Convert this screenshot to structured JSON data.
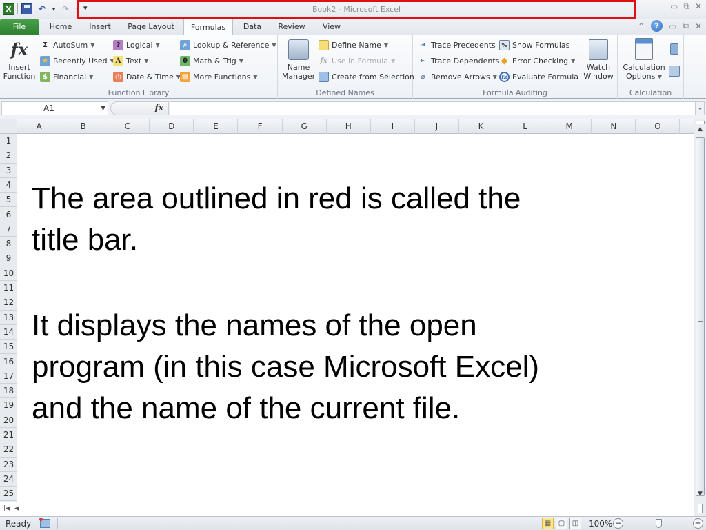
{
  "window": {
    "title": "Book2  -  Microsoft Excel",
    "outline_color": "#e01010",
    "app_icon": "excel-icon"
  },
  "quick_access": {
    "items": [
      {
        "name": "save",
        "icon": "save-icon"
      },
      {
        "name": "undo",
        "icon": "undo-icon"
      },
      {
        "name": "redo",
        "icon": "redo-icon"
      },
      {
        "name": "customize",
        "icon": "customize-qat-icon",
        "glyph": "▾"
      }
    ]
  },
  "window_controls": {
    "minimize": "▭",
    "restore": "⧉",
    "close": "✕"
  },
  "tabs": [
    {
      "label": "File",
      "active": false
    },
    {
      "label": "Home",
      "active": false
    },
    {
      "label": "Insert",
      "active": false
    },
    {
      "label": "Page Layout",
      "active": false
    },
    {
      "label": "Formulas",
      "active": true
    },
    {
      "label": "Data",
      "active": false
    },
    {
      "label": "Review",
      "active": false
    },
    {
      "label": "View",
      "active": false
    }
  ],
  "ribbon_right": {
    "collapse": "⌃",
    "help": "?",
    "minimize": "▭",
    "restore": "⧉",
    "close": "✕"
  },
  "ribbon": {
    "insert_function": {
      "line1": "Insert",
      "line2": "Function",
      "glyph": "fx"
    },
    "function_library": {
      "label": "Function Library",
      "buttons": [
        {
          "label": "AutoSum",
          "dropdown": true,
          "icon": "sigma-icon",
          "glyph": "Σ"
        },
        {
          "label": "Recently Used",
          "dropdown": true,
          "icon": "recently-used-icon",
          "glyph": "★"
        },
        {
          "label": "Financial",
          "dropdown": true,
          "icon": "financial-icon",
          "glyph": "$"
        },
        {
          "label": "Logical",
          "dropdown": true,
          "icon": "logical-icon",
          "glyph": "?"
        },
        {
          "label": "Text",
          "dropdown": true,
          "icon": "text-icon",
          "glyph": "A"
        },
        {
          "label": "Date & Time",
          "dropdown": true,
          "icon": "date-time-icon",
          "glyph": "◷"
        },
        {
          "label": "Lookup & Reference",
          "dropdown": true,
          "icon": "lookup-icon",
          "glyph": "⌕"
        },
        {
          "label": "Math & Trig",
          "dropdown": true,
          "icon": "math-trig-icon",
          "glyph": "θ"
        },
        {
          "label": "More Functions",
          "dropdown": true,
          "icon": "more-functions-icon",
          "glyph": "▤"
        }
      ]
    },
    "defined_names": {
      "label": "Defined Names",
      "name_manager": {
        "line1": "Name",
        "line2": "Manager"
      },
      "buttons": [
        {
          "label": "Define Name",
          "dropdown": true,
          "disabled": false
        },
        {
          "label": "Use in Formula",
          "dropdown": true,
          "disabled": true
        },
        {
          "label": "Create from Selection",
          "dropdown": false,
          "disabled": false
        }
      ]
    },
    "formula_auditing": {
      "label": "Formula Auditing",
      "buttons": [
        {
          "label": "Trace Precedents",
          "dropdown": false
        },
        {
          "label": "Trace Dependents",
          "dropdown": false
        },
        {
          "label": "Remove Arrows",
          "dropdown": true
        },
        {
          "label": "Show Formulas",
          "dropdown": false
        },
        {
          "label": "Error Checking",
          "dropdown": true
        },
        {
          "label": "Evaluate Formula",
          "dropdown": false
        }
      ],
      "watch_window": {
        "line1": "Watch",
        "line2": "Window"
      }
    },
    "calculation": {
      "label": "Calculation",
      "options": {
        "line1": "Calculation",
        "line2": "Options"
      }
    }
  },
  "formula_bar": {
    "name_box": "A1",
    "fx_label": "fx",
    "formula_value": ""
  },
  "grid": {
    "columns": [
      "A",
      "B",
      "C",
      "D",
      "E",
      "F",
      "G",
      "H",
      "I",
      "J",
      "K",
      "L",
      "M",
      "N",
      "O"
    ],
    "rows": [
      "1",
      "2",
      "3",
      "4",
      "5",
      "6",
      "7",
      "8",
      "9",
      "10",
      "11",
      "12",
      "13",
      "14",
      "15",
      "16",
      "17",
      "18",
      "19",
      "20",
      "21",
      "22",
      "23",
      "24",
      "25"
    ]
  },
  "note": {
    "paragraph1": [
      "The area outlined in red is called the",
      "title bar."
    ],
    "paragraph2": [
      "It displays the names of the open",
      "program (in this case Microsoft  Excel)",
      "and the name of the current file."
    ]
  },
  "status_bar": {
    "status": "Ready",
    "zoom_level": "100%",
    "zoom_percent": 100,
    "views": [
      "Normal",
      "Page Layout",
      "Page Break Preview"
    ],
    "active_view": "Normal"
  }
}
